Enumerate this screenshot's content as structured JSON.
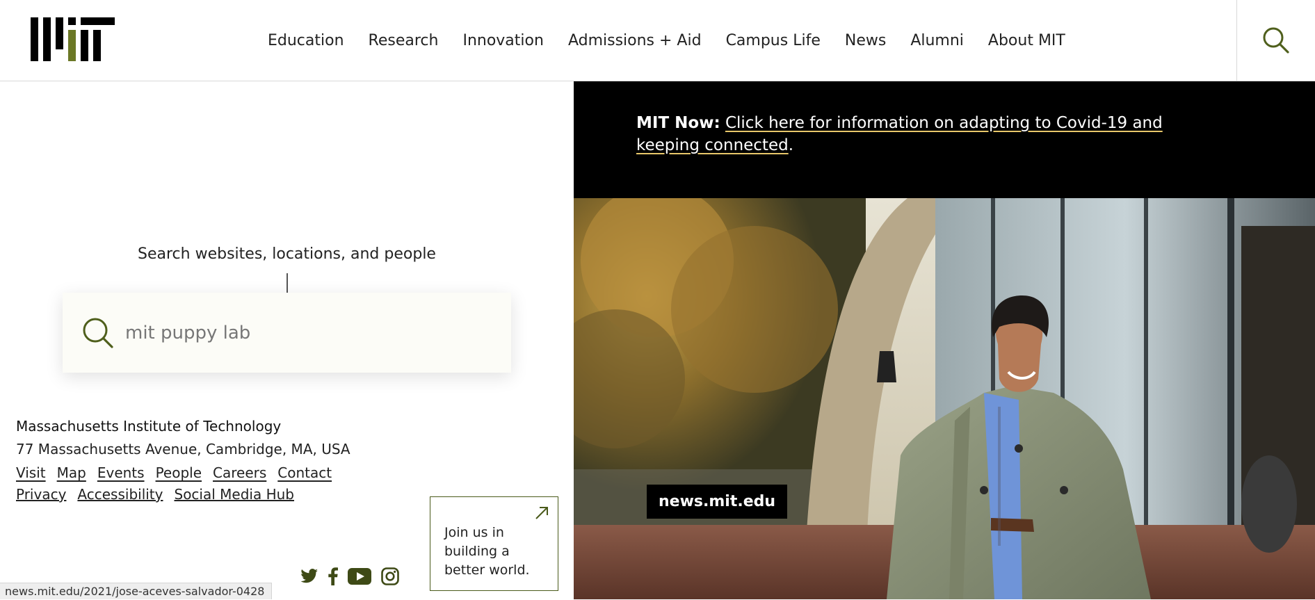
{
  "header": {
    "logo_text": "MIT",
    "nav": [
      {
        "label": "Education"
      },
      {
        "label": "Research"
      },
      {
        "label": "Innovation"
      },
      {
        "label": "Admissions + Aid"
      },
      {
        "label": "Campus Life"
      },
      {
        "label": "News"
      },
      {
        "label": "Alumni"
      },
      {
        "label": "About MIT"
      }
    ],
    "search_icon": "search-icon"
  },
  "search": {
    "prompt": "Search websites, locations, and people",
    "value": "mit puppy lab",
    "icon": "search-icon"
  },
  "footer": {
    "institution": "Massachusetts Institute of Technology",
    "address": "77 Massachusetts Avenue, Cambridge, MA, USA",
    "links": [
      {
        "label": "Visit"
      },
      {
        "label": "Map"
      },
      {
        "label": "Events"
      },
      {
        "label": "People"
      },
      {
        "label": "Careers"
      },
      {
        "label": "Contact"
      }
    ],
    "links2": [
      {
        "label": "Privacy"
      },
      {
        "label": "Accessibility"
      },
      {
        "label": "Social Media Hub"
      }
    ],
    "socials": [
      "twitter-icon",
      "facebook-icon",
      "youtube-icon",
      "instagram-icon"
    ],
    "join": "Join us in building a better world."
  },
  "banner": {
    "lead": "MIT Now:",
    "link_text": "Click here for information on adapting to Covid-19 and keeping connected",
    "suffix": "."
  },
  "hero": {
    "tag": "news.mit.edu"
  },
  "status_bar": {
    "url": "news.mit.edu/2021/jose-aceves-salvador-0428"
  },
  "colors": {
    "accent_olive": "#5b6b24",
    "banner_bg": "#000000",
    "underline_gold": "#e8c76a"
  }
}
